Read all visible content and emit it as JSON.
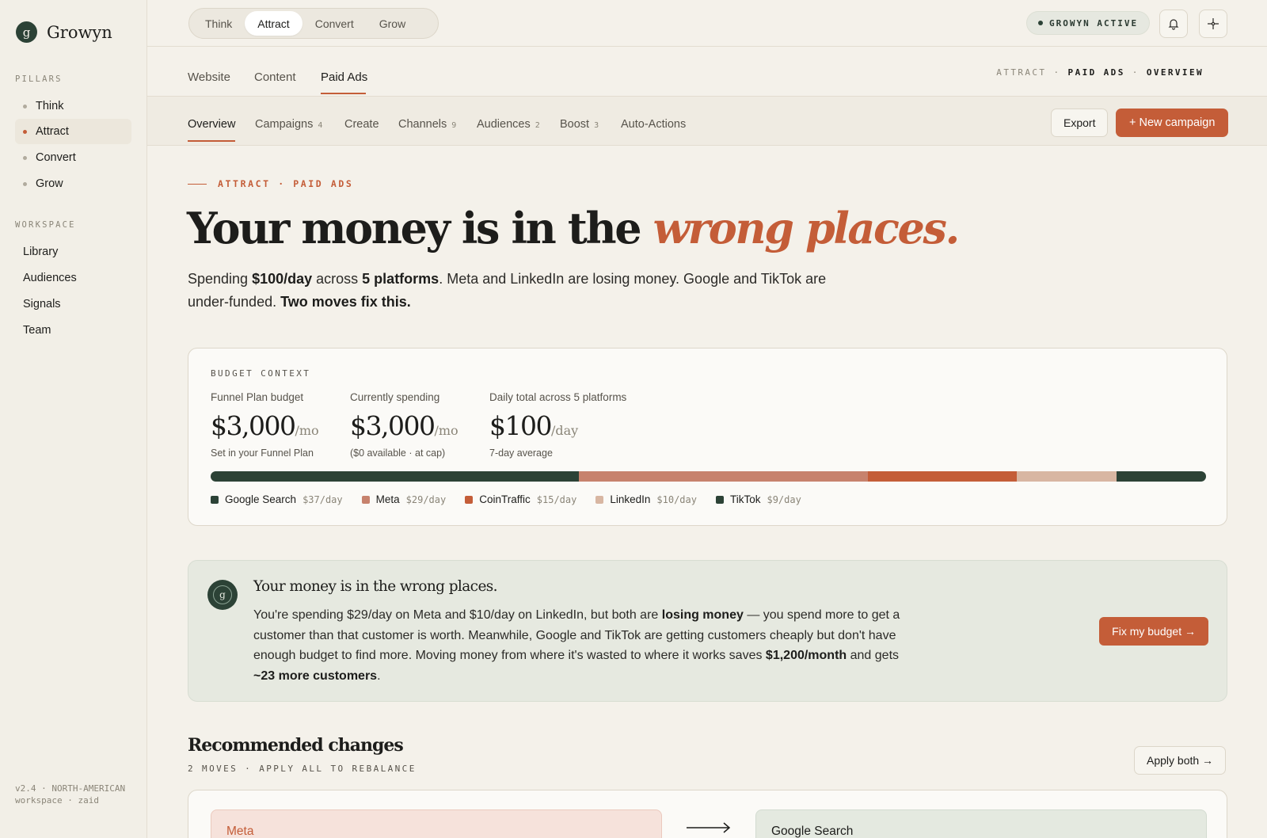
{
  "brand": {
    "mark": "g",
    "name": "Growyn"
  },
  "sidebar": {
    "pillars_label": "PILLARS",
    "pillars": [
      "Think",
      "Attract",
      "Convert",
      "Grow"
    ],
    "workspace_label": "WORKSPACE",
    "workspace": [
      "Library",
      "Audiences",
      "Signals",
      "Team"
    ],
    "footer": "v2.4 · NORTH-AMERICAN workspace · zaid"
  },
  "topbar": {
    "segments": [
      "Think",
      "Attract",
      "Convert",
      "Grow"
    ],
    "status": "GROWYN ACTIVE",
    "bell_icon": "bell-icon",
    "sparkle_icon": "sparkle-icon"
  },
  "section_tabs": [
    "Website",
    "Content",
    "Paid Ads"
  ],
  "breadcrumb": {
    "a": "ATTRACT",
    "b": "PAID ADS",
    "c": "OVERVIEW"
  },
  "sub_tabs": [
    {
      "label": "Overview",
      "count": ""
    },
    {
      "label": "Campaigns",
      "count": "4"
    },
    {
      "label": "Create",
      "count": ""
    },
    {
      "label": "Channels",
      "count": "9"
    },
    {
      "label": "Audiences",
      "count": "2"
    },
    {
      "label": "Boost",
      "count": "3"
    },
    {
      "label": "Auto-Actions",
      "count": ""
    }
  ],
  "actions": {
    "export": "Export",
    "new_campaign": "+ New campaign"
  },
  "hero": {
    "eyebrow": "ATTRACT · PAID ADS",
    "headline_plain": "Your money is in the ",
    "headline_accent": "wrong places.",
    "lede_1": "Spending ",
    "lede_b1": "$100/day",
    "lede_2": " across ",
    "lede_b2": "5 platforms",
    "lede_3": ". Meta and LinkedIn are losing money. Google and TikTok are under-funded. ",
    "lede_b3": "Two moves fix this."
  },
  "budget": {
    "label": "BUDGET CONTEXT",
    "stats": [
      {
        "label": "Funnel Plan budget",
        "value": "$3,000",
        "unit": "/mo",
        "sub": "Set in your Funnel Plan"
      },
      {
        "label": "Currently spending",
        "value": "$3,000",
        "unit": "/mo",
        "sub": "($0 available · at cap)"
      },
      {
        "label": "Daily total across 5 platforms",
        "value": "$100",
        "unit": "/day",
        "sub": "7-day average"
      }
    ],
    "platforms": [
      {
        "name": "Google Search",
        "amount": "$37/day",
        "value": 37,
        "color": "#2c4236"
      },
      {
        "name": "Meta",
        "amount": "$29/day",
        "value": 29,
        "color": "#c7826d"
      },
      {
        "name": "CoinTraffic",
        "amount": "$15/day",
        "value": 15,
        "color": "#c45d38"
      },
      {
        "name": "LinkedIn",
        "amount": "$10/day",
        "value": 10,
        "color": "#d8b6a2"
      },
      {
        "name": "TikTok",
        "amount": "$9/day",
        "value": 9,
        "color": "#2c4236"
      }
    ]
  },
  "insight": {
    "title": "Your money is in the wrong places.",
    "b1": "You're spending $29/day on Meta and $10/day on LinkedIn, but both are ",
    "b1_bold": "losing money",
    "b2": " — you spend more to get a customer than that customer is worth. Meanwhile, Google and TikTok are getting customers cheaply but don't have enough budget to find more. Moving money from where it's wasted to where it works saves ",
    "b2_bold": "$1,200/month",
    "b3": " and gets ",
    "b3_bold": "~23 more customers",
    "b4": ".",
    "cta": "Fix my budget →"
  },
  "recommended": {
    "title": "Recommended changes",
    "sub": "2 MOVES · APPLY ALL TO REBALANCE",
    "apply": "Apply both →",
    "from": "Meta",
    "to": "Google Search"
  },
  "colors": {
    "accent": "#c45d38",
    "forest": "#2c4236",
    "background": "#f4f1ea"
  }
}
